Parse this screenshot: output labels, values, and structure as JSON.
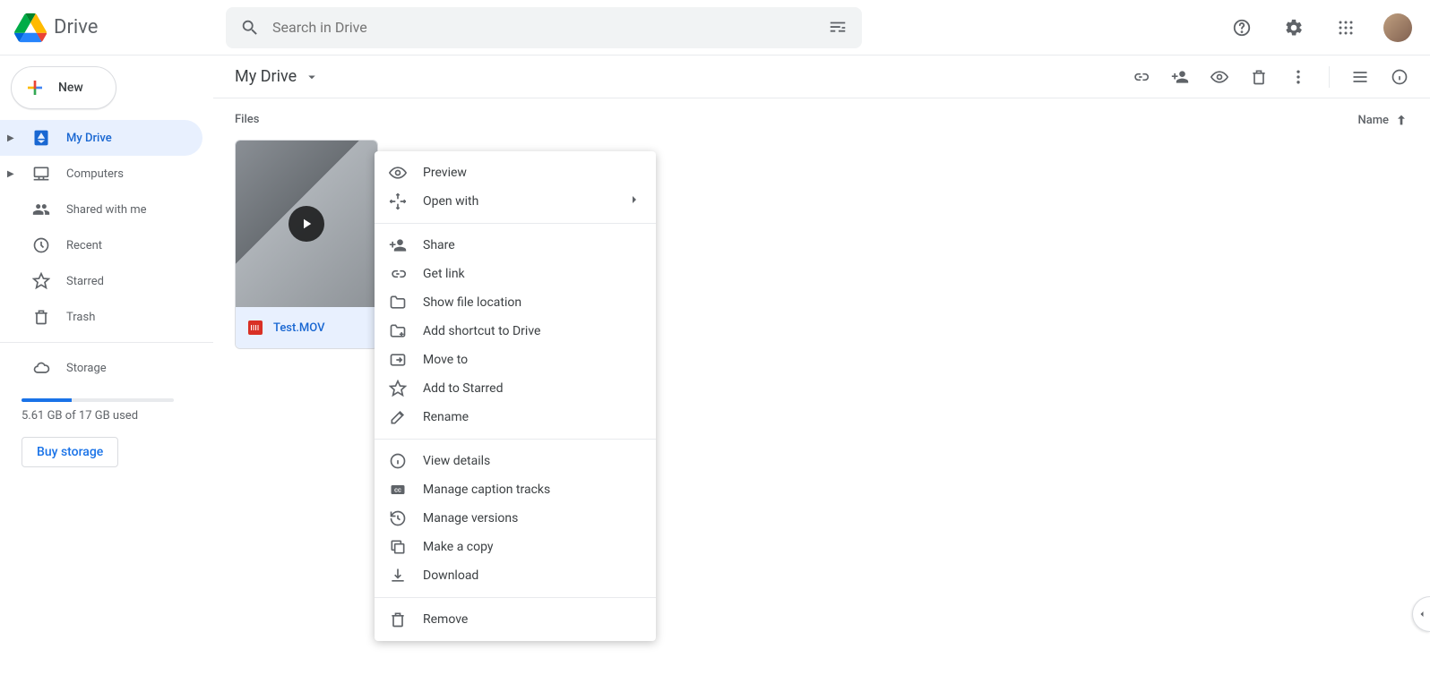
{
  "header": {
    "product_name": "Drive",
    "search_placeholder": "Search in Drive"
  },
  "sidebar": {
    "new_label": "New",
    "items": [
      {
        "label": "My Drive"
      },
      {
        "label": "Computers"
      },
      {
        "label": "Shared with me"
      },
      {
        "label": "Recent"
      },
      {
        "label": "Starred"
      },
      {
        "label": "Trash"
      }
    ],
    "storage_label": "Storage",
    "storage_used_text": "5.61 GB of 17 GB used",
    "storage_percent": 33,
    "buy_label": "Buy storage"
  },
  "main": {
    "breadcrumb": "My Drive",
    "columns": {
      "files_label": "Files",
      "name_label": "Name"
    },
    "files": [
      {
        "name": "Test.MOV"
      }
    ]
  },
  "context_menu": {
    "items": [
      {
        "label": "Preview",
        "icon": "eye"
      },
      {
        "label": "Open with",
        "icon": "open-with",
        "submenu": true
      },
      {
        "sep": true
      },
      {
        "label": "Share",
        "icon": "person-add"
      },
      {
        "label": "Get link",
        "icon": "link"
      },
      {
        "label": "Show file location",
        "icon": "folder"
      },
      {
        "label": "Add shortcut to Drive",
        "icon": "folder-shortcut"
      },
      {
        "label": "Move to",
        "icon": "move"
      },
      {
        "label": "Add to Starred",
        "icon": "star"
      },
      {
        "label": "Rename",
        "icon": "rename"
      },
      {
        "sep": true
      },
      {
        "label": "View details",
        "icon": "info"
      },
      {
        "label": "Manage caption tracks",
        "icon": "cc"
      },
      {
        "label": "Manage versions",
        "icon": "history"
      },
      {
        "label": "Make a copy",
        "icon": "copy"
      },
      {
        "label": "Download",
        "icon": "download"
      },
      {
        "sep": true
      },
      {
        "label": "Remove",
        "icon": "trash"
      }
    ]
  }
}
